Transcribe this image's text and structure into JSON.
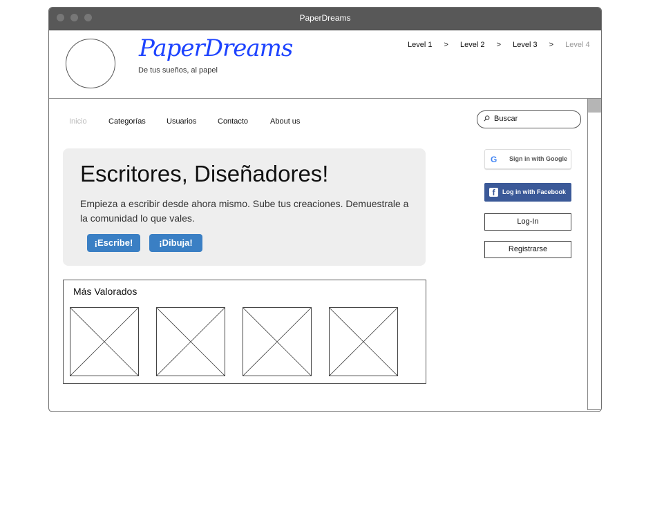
{
  "window": {
    "title": "PaperDreams"
  },
  "header": {
    "brand": "PaperDreams",
    "tagline": "De tus sueños, al papel",
    "breadcrumb": [
      "Level 1",
      "Level 2",
      "Level 3",
      "Level 4"
    ],
    "breadcrumb_separator": ">"
  },
  "nav": {
    "items": [
      "Inicio",
      "Categorías",
      "Usuarios",
      "Contacto",
      "About us"
    ],
    "active": "Inicio"
  },
  "search": {
    "placeholder": "Buscar"
  },
  "hero": {
    "title": "Escritores, Diseñadores!",
    "text": "Empieza a escribir desde ahora mismo. Sube tus creaciones. Demuestrale a la comunidad lo que vales.",
    "buttons": [
      "¡Escribe!",
      "¡Dibuja!"
    ]
  },
  "top_rated": {
    "title": "Más Valorados",
    "thumbnails": 4
  },
  "auth": {
    "google_label": "Sign in with Google",
    "facebook_label": "Log in with Facebook",
    "login_label": "Log-In",
    "register_label": "Registrarse"
  },
  "colors": {
    "brand": "#1d43ff",
    "primary_button": "#3a7fc4",
    "facebook": "#3b5998",
    "titlebar": "#585858"
  }
}
